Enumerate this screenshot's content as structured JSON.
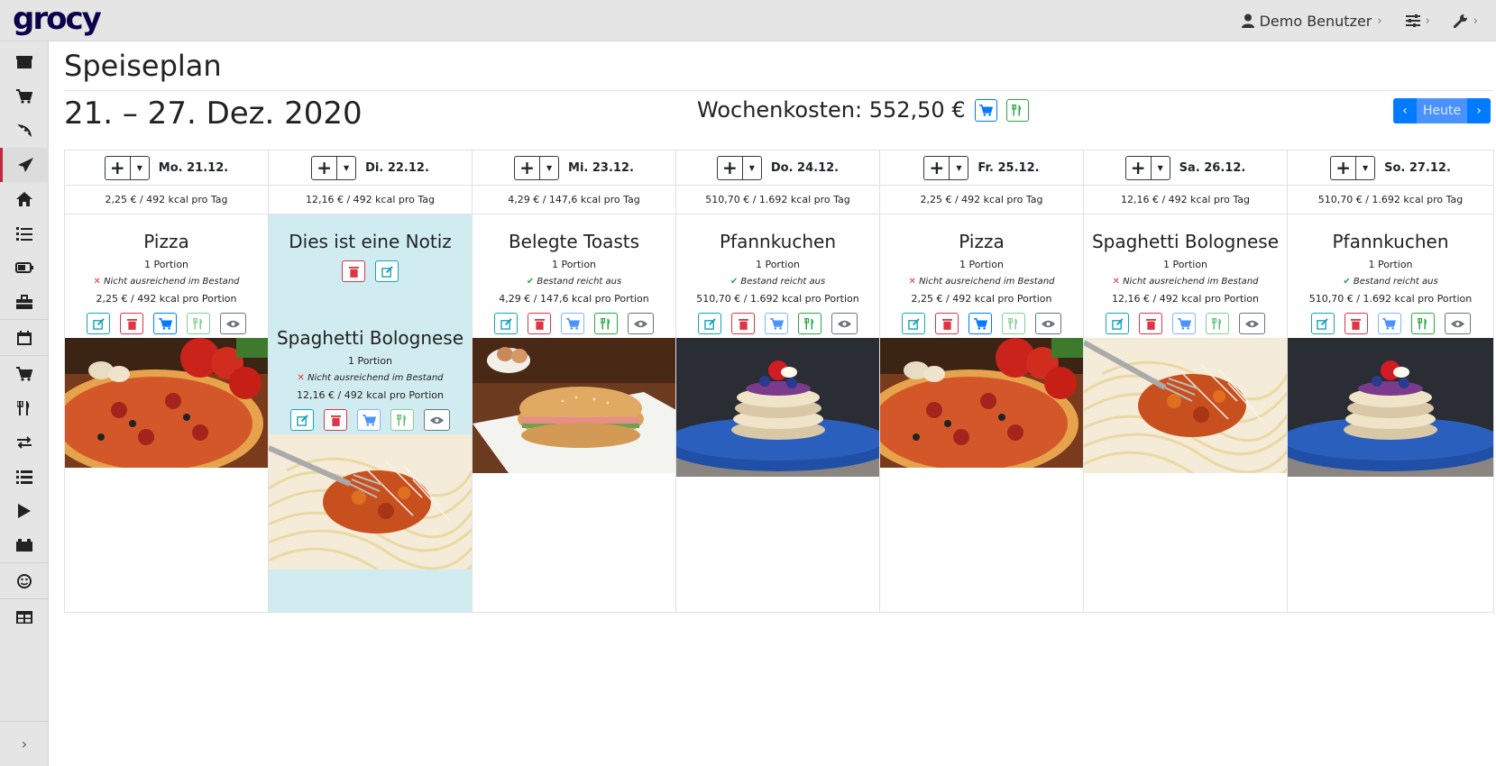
{
  "app": {
    "logo": "grocy"
  },
  "topnav": {
    "user": "Demo Benutzer"
  },
  "page": {
    "title": "Speiseplan",
    "week": "21. – 27. Dez. 2020",
    "week_costs": "Wochenkosten: 552,50 €",
    "today_button": "Heute"
  },
  "days": [
    {
      "label": "Mo. 21.12.",
      "summary": "2,25 € / 492 kcal pro Tag"
    },
    {
      "label": "Di. 22.12.",
      "summary": "12,16 € / 492 kcal pro Tag"
    },
    {
      "label": "Mi. 23.12.",
      "summary": "4,29 € / 147,6 kcal pro Tag"
    },
    {
      "label": "Do. 24.12.",
      "summary": "510,70 € / 1.692 kcal pro Tag"
    },
    {
      "label": "Fr. 25.12.",
      "summary": "2,25 € / 492 kcal pro Tag"
    },
    {
      "label": "Sa. 26.12.",
      "summary": "12,16 € / 492 kcal pro Tag"
    },
    {
      "label": "So. 27.12.",
      "summary": "510,70 € / 1.692 kcal pro Tag"
    }
  ],
  "note": {
    "text": "Dies ist eine Notiz"
  },
  "entries": [
    {
      "name": "Pizza",
      "portion": "1 Portion",
      "stock": "Nicht ausreichend im Bestand",
      "costs": "2,25 € / 492 kcal pro Portion"
    },
    {
      "name": "Spaghetti Bolognese",
      "portion": "1 Portion",
      "stock": "Nicht ausreichend im Bestand",
      "costs": "12,16 € / 492 kcal pro Portion"
    },
    {
      "name": "Belegte Toasts",
      "portion": "1 Portion",
      "stock": "Bestand reicht aus",
      "costs": "4,29 € / 147,6 kcal pro Portion"
    },
    {
      "name": "Pfannkuchen",
      "portion": "1 Portion",
      "stock": "Bestand reicht aus",
      "costs": "510,70 € / 1.692 kcal pro Portion"
    },
    {
      "name": "Pizza",
      "portion": "1 Portion",
      "stock": "Nicht ausreichend im Bestand",
      "costs": "2,25 € / 492 kcal pro Portion"
    },
    {
      "name": "Spaghetti Bolognese",
      "portion": "1 Portion",
      "stock": "Nicht ausreichend im Bestand",
      "costs": "12,16 € / 492 kcal pro Portion"
    },
    {
      "name": "Pfannkuchen",
      "portion": "1 Portion",
      "stock": "Bestand reicht aus",
      "costs": "510,70 € / 1.692 kcal pro Portion"
    }
  ],
  "colors": {
    "accent": "#007bff",
    "danger": "#dc3545",
    "success": "#28a745",
    "info": "#17a2b8",
    "note_bg": "#d1ecf1"
  }
}
